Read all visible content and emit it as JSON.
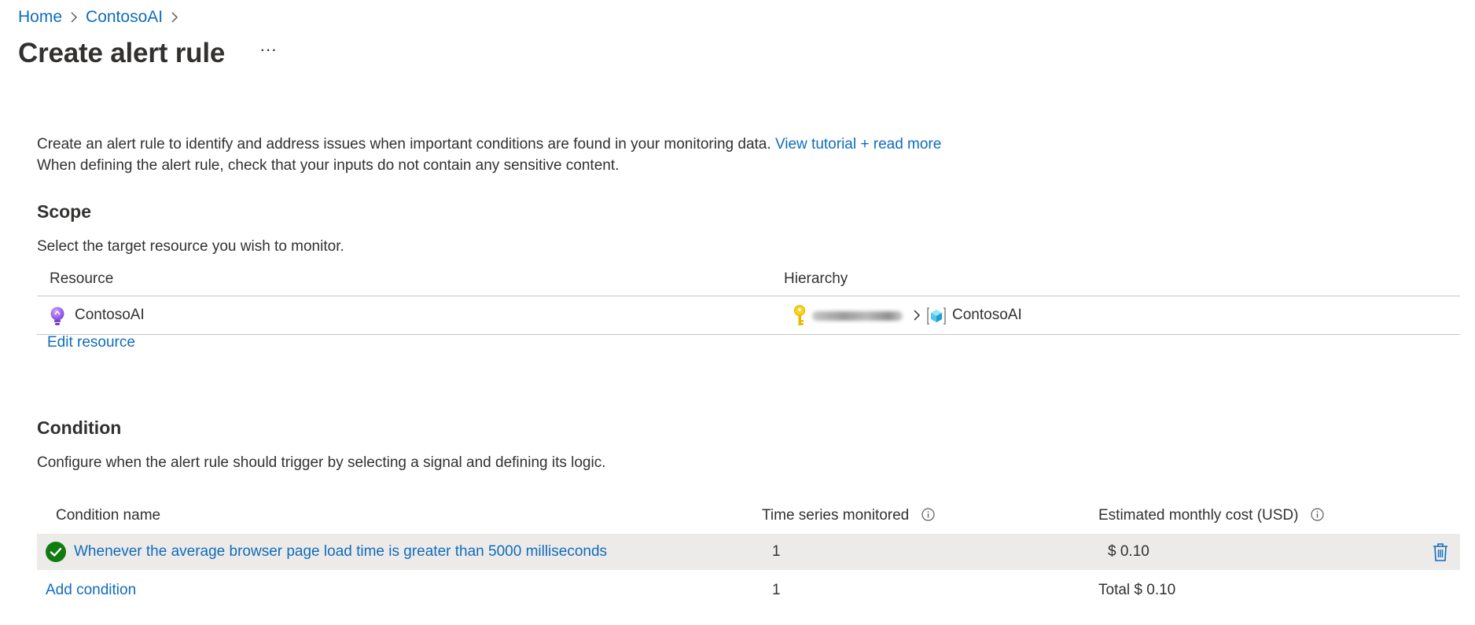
{
  "breadcrumb": {
    "items": [
      "Home",
      "ContosoAI"
    ]
  },
  "page": {
    "title": "Create alert rule",
    "more_label": "···"
  },
  "intro": {
    "line1": "Create an alert rule to identify and address issues when important conditions are found in your monitoring data.",
    "link": "View tutorial + read more",
    "line2": "When defining the alert rule, check that your inputs do not contain any sensitive content."
  },
  "scope": {
    "title": "Scope",
    "description": "Select the target resource you wish to monitor.",
    "columns": [
      "Resource",
      "Hierarchy"
    ],
    "row": {
      "resource": "ContosoAI",
      "hierarchy_target": "ContosoAI"
    },
    "edit_label": "Edit resource"
  },
  "condition": {
    "title": "Condition",
    "description": "Configure when the alert rule should trigger by selecting a signal and defining its logic.",
    "columns": {
      "name": "Condition name",
      "series": "Time series monitored",
      "cost": "Estimated monthly cost (USD)"
    },
    "row": {
      "name": "Whenever the average browser page load time is greater than 5000 milliseconds",
      "series": "1",
      "cost": "$ 0.10"
    },
    "add_label": "Add condition",
    "total_series": "1",
    "total_cost": "Total $ 0.10"
  },
  "colors": {
    "link": "#0f6cbd",
    "success": "#107c10",
    "row_highlight": "#edebe9",
    "divider": "#c8c6c4",
    "text": "#323130"
  }
}
